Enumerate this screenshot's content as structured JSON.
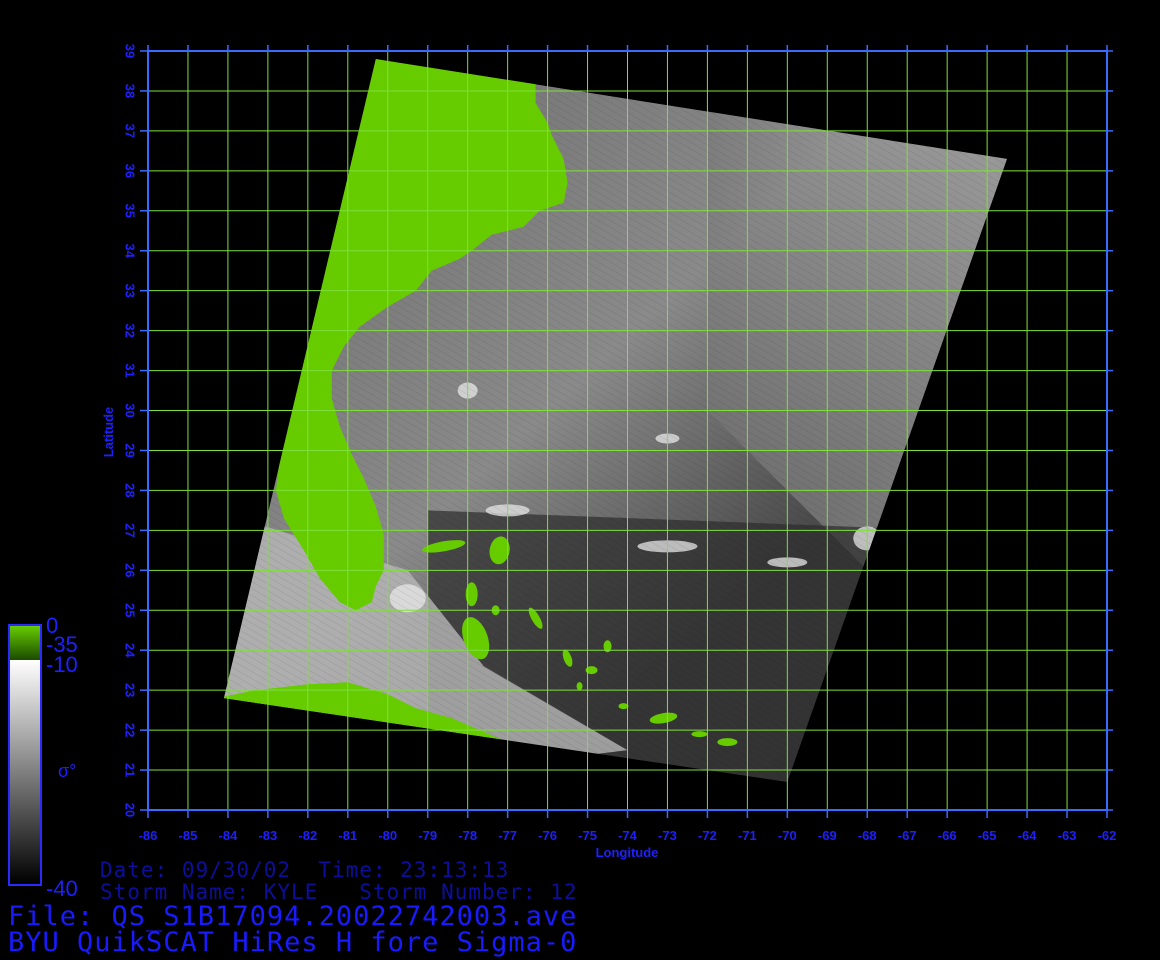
{
  "map": {
    "lon_ticks": [
      "-86",
      "-85",
      "-84",
      "-83",
      "-82",
      "-81",
      "-80",
      "-79",
      "-78",
      "-77",
      "-76",
      "-75",
      "-74",
      "-73",
      "-72",
      "-71",
      "-70",
      "-69",
      "-68",
      "-67",
      "-66",
      "-65",
      "-64",
      "-63",
      "-62"
    ],
    "lat_ticks": [
      "20",
      "21",
      "22",
      "23",
      "24",
      "25",
      "26",
      "27",
      "28",
      "29",
      "30",
      "31",
      "32",
      "33",
      "34",
      "35",
      "36",
      "37",
      "38",
      "39"
    ],
    "lon_range": [
      -86,
      -62
    ],
    "lat_range": [
      20,
      39
    ],
    "xlabel": "Longitude",
    "ylabel": "Latitude",
    "grid": true,
    "colors": {
      "frame": "#3a6bff",
      "grid": "#7ee03a",
      "land": "#66cc00",
      "axis_text": "#1f1fff"
    },
    "swath_corners_latlon": [
      [
        38.8,
        -80.3
      ],
      [
        36.3,
        -64.5
      ],
      [
        20.7,
        -70.0
      ],
      [
        22.8,
        -84.1
      ]
    ],
    "florida_keys_island_center": [
      24.3,
      -77.8
    ]
  },
  "colorbar": {
    "top_label": "0",
    "upper_label": "-35",
    "mid_label": "-10",
    "symbol": "σ°",
    "bottom_label": "-40"
  },
  "info": {
    "date_time": "Date: 09/30/02  Time: 23:13:13",
    "storm": "Storm Name: KYLE   Storm Number: 12",
    "file": "File: QS_S1B17094.20022742003.ave",
    "product": "BYU QuikSCAT HiRes H fore Sigma-0"
  }
}
